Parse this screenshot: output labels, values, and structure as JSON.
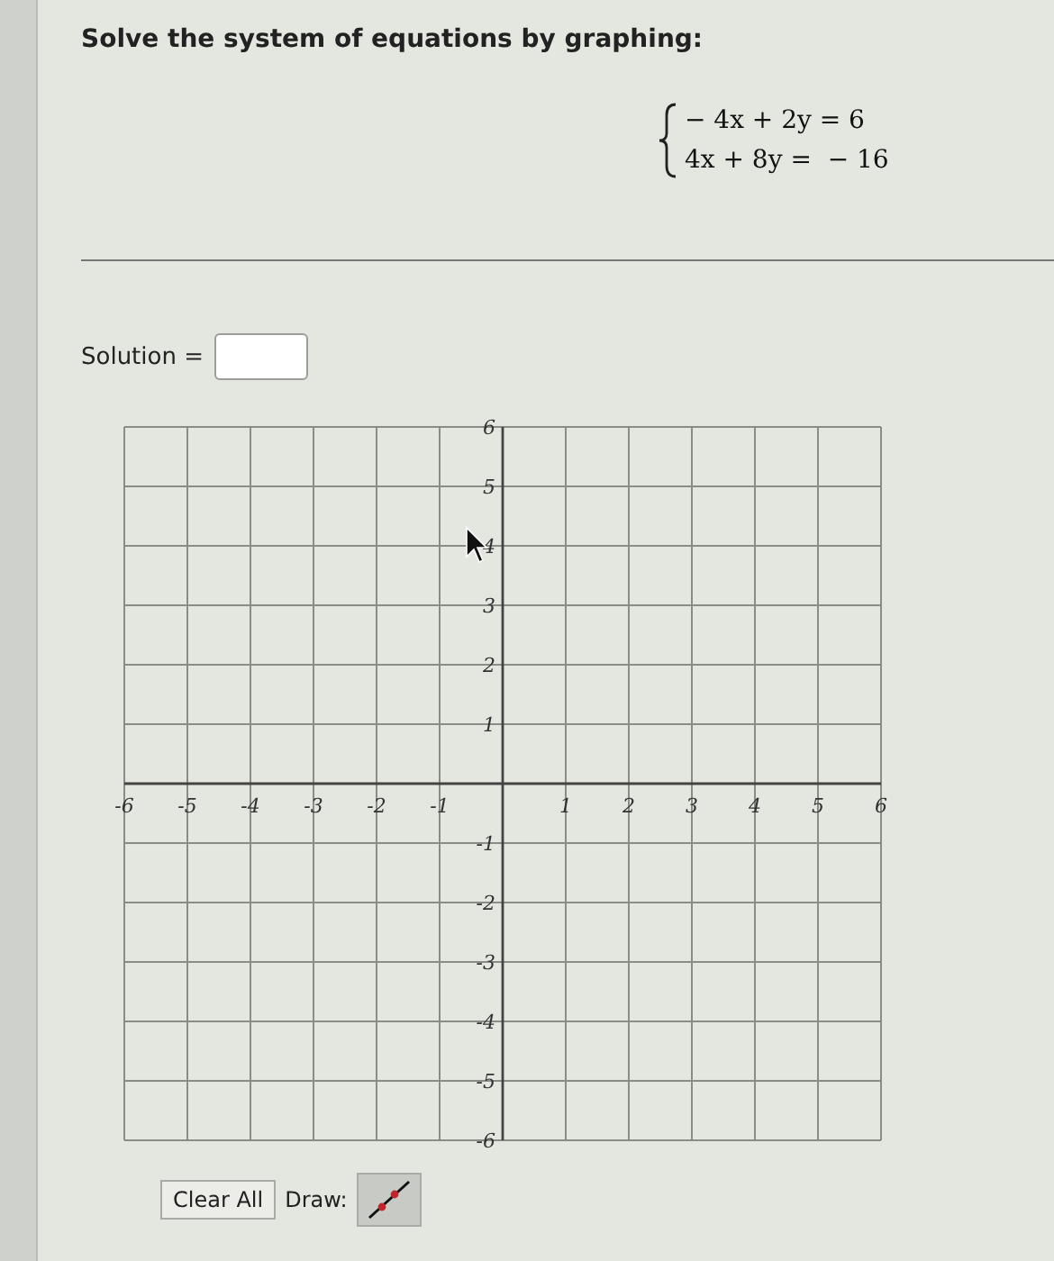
{
  "prompt": "Solve the system of equations by graphing:",
  "equations": [
    "− 4x + 2y = 6",
    "4x + 8y =  − 16"
  ],
  "solution": {
    "label": "Solution ="
  },
  "graph": {
    "x_ticks": [
      "-6",
      "-5",
      "-4",
      "-3",
      "-2",
      "-1",
      "1",
      "2",
      "3",
      "4",
      "5",
      "6"
    ],
    "y_ticks": [
      "6",
      "5",
      "4",
      "3",
      "2",
      "1",
      "-1",
      "-2",
      "-3",
      "-4",
      "-5",
      "-6"
    ]
  },
  "controls": {
    "clear_button": "Clear All",
    "draw_label": "Draw:",
    "line_tool": {
      "selected": true
    }
  }
}
